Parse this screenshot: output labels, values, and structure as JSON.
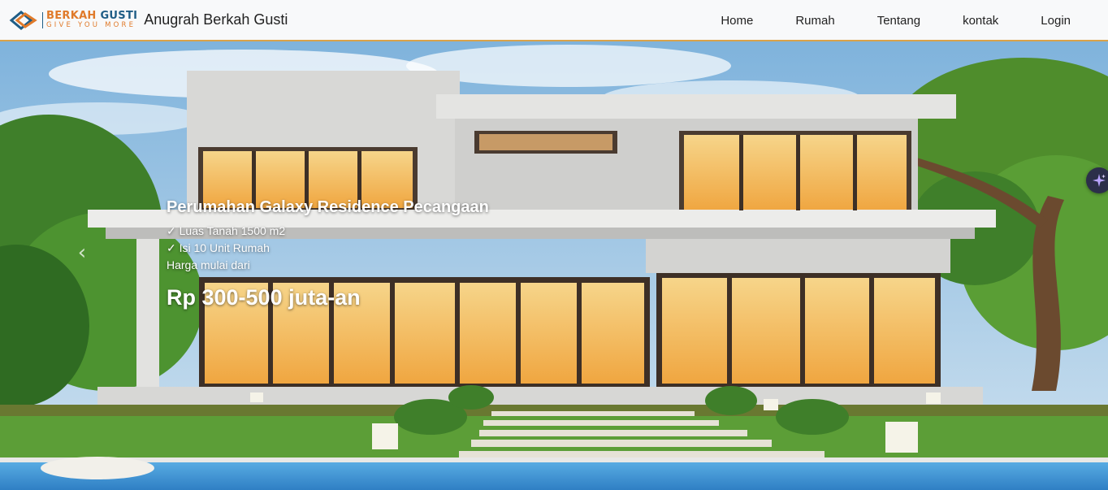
{
  "brand": {
    "logo_word_part1": "BERKAH",
    "logo_word_part2": "GUSTI",
    "logo_tagline": "GIVE YOU MORE",
    "name": "Anugrah Berkah Gusti",
    "colors": {
      "orange": "#e07a2a",
      "blue": "#1f5d86"
    }
  },
  "nav": {
    "items": [
      {
        "label": "Home"
      },
      {
        "label": "Rumah"
      },
      {
        "label": "Tentang"
      },
      {
        "label": "kontak"
      },
      {
        "label": "Login"
      }
    ],
    "accent_border": "#d9a24a"
  },
  "hero": {
    "title": "Perumahan Galaxy Residence Pecangaan",
    "lines": [
      "✓ Luas Tanah 1500 m2",
      "✓ Isi 10 Unit Rumah",
      "Harga mulai dari"
    ],
    "price": "Rp 300-500 juta-an",
    "prev_icon": "chevron-left-icon",
    "assistant_icon": "sparkle-icon"
  }
}
